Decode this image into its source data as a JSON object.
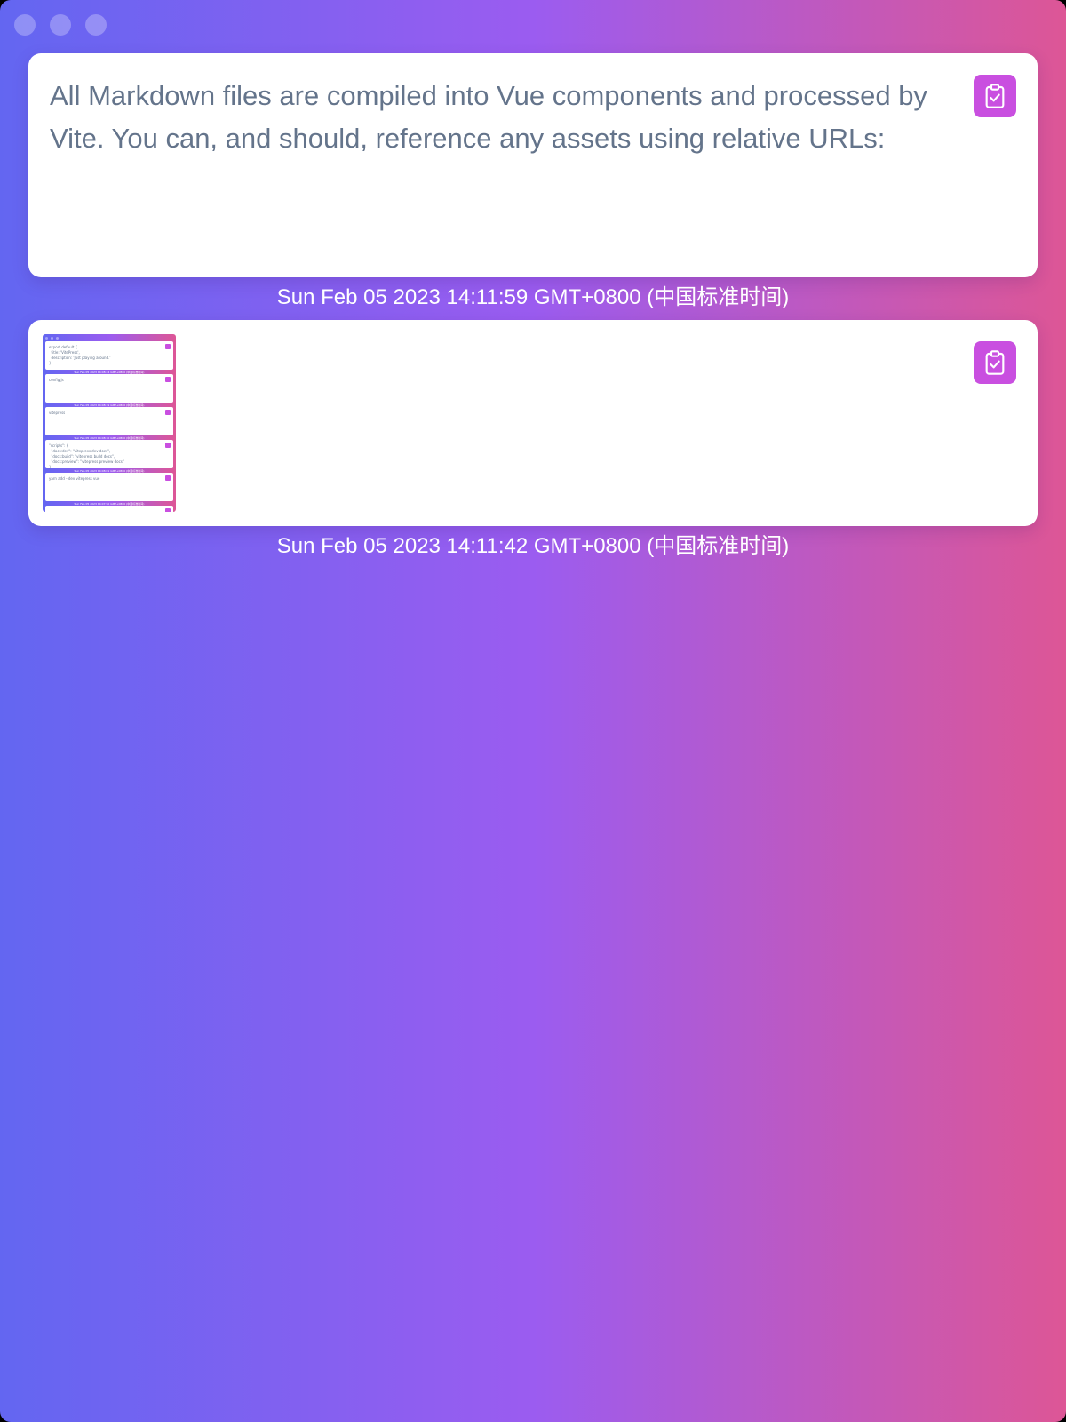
{
  "window": {
    "controls": [
      "close",
      "minimize",
      "maximize"
    ]
  },
  "colors": {
    "gradient_start": "#6366f1",
    "gradient_mid": "#9b5cf0",
    "gradient_end": "#dd5696",
    "button": "#c94fe0",
    "card_text": "#64748b"
  },
  "items": [
    {
      "text": "All Markdown files are compiled into Vue components and processed by Vite. You can, and should, reference any assets using relative URLs:",
      "timestamp": "Sun Feb 05 2023 14:11:59 GMT+0800 (中国标准时间)",
      "copy_icon": "clipboard-check-icon"
    },
    {
      "image": "screenshot-thumbnail",
      "timestamp": "Sun Feb 05 2023 14:11:42 GMT+0800 (中国标准时间)",
      "copy_icon": "clipboard-check-icon"
    }
  ],
  "thumbnail": {
    "cards": [
      {
        "text": "export default {\n  title: 'VitePress',\n  description: 'Just playing around.'\n}",
        "timestamp": "Sun Feb 05 2023 14:08:24 GMT+0800 (中国标准时间)"
      },
      {
        "text": "config.js",
        "timestamp": "Sun Feb 05 2023 14:08:19 GMT+0800 (中国标准时间)"
      },
      {
        "text": "vitepress",
        "timestamp": "Sun Feb 05 2023 14:08:10 GMT+0800 (中国标准时间)"
      },
      {
        "text": "\"scripts\": {\n  \"docs:dev\": \"vitepress dev docs\",\n  \"docs:build\": \"vitepress build docs\",\n  \"docs:preview\": \"vitepress preview docs\"\n}",
        "timestamp": "Sun Feb 05 2023 14:08:01 GMT+0800 (中国标准时间)"
      },
      {
        "text": "yarn add --dev vitepress vue",
        "timestamp": "Sun Feb 05 2023 14:07:50 GMT+0800 (中国标准时间)"
      }
    ]
  }
}
